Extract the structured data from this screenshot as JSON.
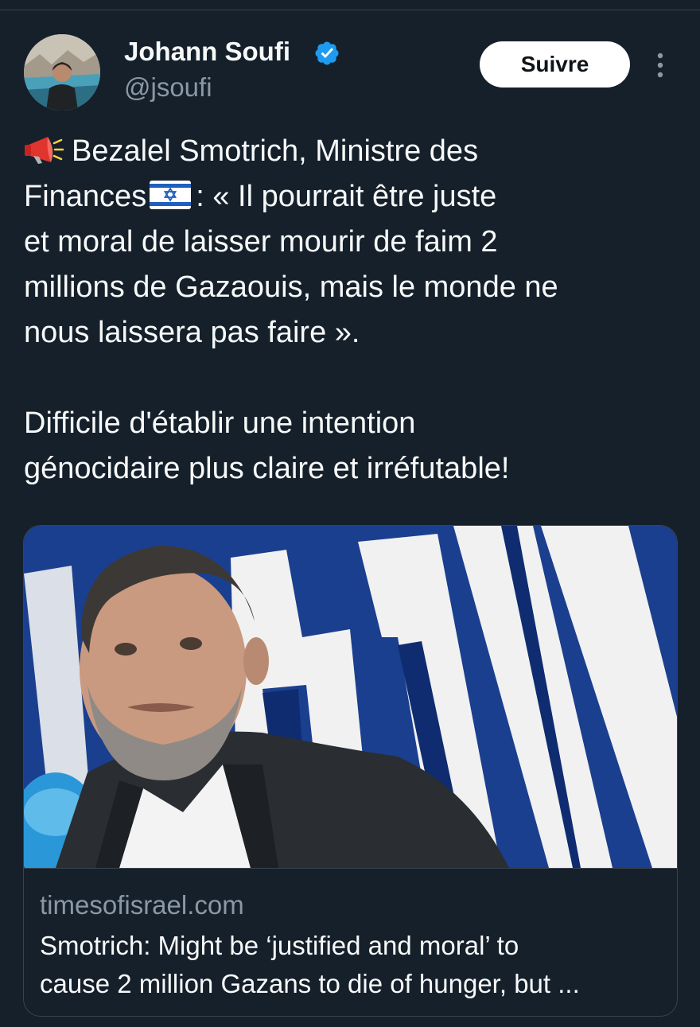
{
  "tweet": {
    "author": {
      "name": "Johann Soufi",
      "handle": "@jsoufi",
      "verified": true,
      "avatar_icon": "profile-photo"
    },
    "follow_label": "Suivre",
    "more_icon": "more-vertical-icon",
    "text_lines": [
      {
        "prefix_icon": "megaphone-icon",
        "text": "Bezalel Smotrich, Ministre des"
      },
      {
        "text_before_flag": "Finances",
        "flag_icon": "israel-flag-icon",
        "text_after_flag": ": « Il pourrait être juste"
      },
      {
        "text": "et moral de laisser mourir de faim 2"
      },
      {
        "text": "millions de Gazaouis, mais le monde ne"
      },
      {
        "text": "nous laissera pas faire »."
      },
      {
        "text": "Difficile d'établir une intention"
      },
      {
        "text": "génocidaire plus claire et irréfutable!"
      }
    ],
    "link_card": {
      "image": "photo-of-speaker-at-press-conference",
      "domain": "timesofisrael.com",
      "title_lines": [
        "Smotrich: Might be ‘justified and moral’ to",
        "cause 2 million Gazans to die of hunger, but ..."
      ]
    }
  },
  "colors": {
    "background": "#15202b",
    "text_primary": "#f7f9f9",
    "text_secondary": "#8b98a5",
    "border": "#38444d",
    "verified_blue": "#1d9bf0",
    "button_bg": "#ffffff"
  }
}
